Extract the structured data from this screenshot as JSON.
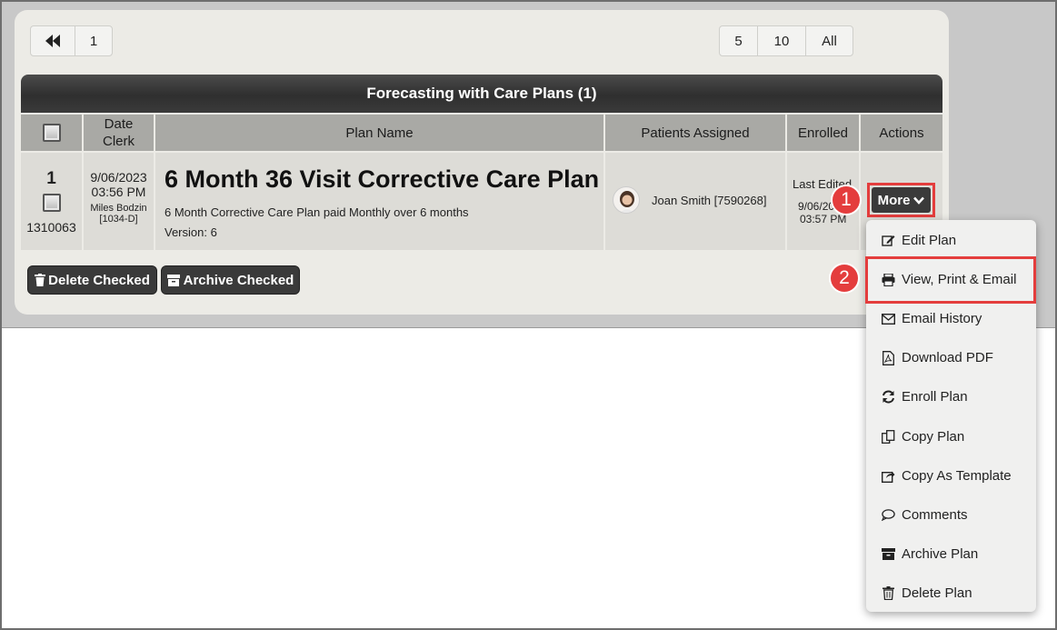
{
  "pager": {
    "first_icon": "double-left-arrow-icon",
    "page": "1",
    "sizes": [
      "5",
      "10",
      "All"
    ]
  },
  "table": {
    "title": "Forecasting with Care Plans (1)",
    "headers": {
      "date_clerk": "Date\nClerk",
      "plan_name": "Plan Name",
      "patients_assigned": "Patients Assigned",
      "enrolled": "Enrolled",
      "actions": "Actions"
    },
    "row": {
      "index": "1",
      "id": "1310063",
      "date": "9/06/2023",
      "time": "03:56 PM",
      "clerk": "Miles Bodzin",
      "clerk_code": "[1034-D]",
      "plan_title": "6 Month 36 Visit Corrective Care Plan",
      "plan_desc": "6 Month Corrective Care Plan paid Monthly over 6 months",
      "version": "Version: 6",
      "patient": "Joan Smith [7590268]",
      "last_edited": "Last Edited",
      "edited_date": "9/06/2023",
      "edited_time": "03:57 PM",
      "more_label": "More"
    }
  },
  "buttons": {
    "delete_checked": "Delete Checked",
    "archive_checked": "Archive Checked"
  },
  "menu": {
    "items": [
      {
        "label": "Edit Plan",
        "icon": "edit-icon"
      },
      {
        "label": "View, Print & Email",
        "icon": "print-icon"
      },
      {
        "label": "Email History",
        "icon": "envelope-icon"
      },
      {
        "label": "Download PDF",
        "icon": "pdf-icon"
      },
      {
        "label": "Enroll Plan",
        "icon": "refresh-icon"
      },
      {
        "label": "Copy Plan",
        "icon": "copy-icon"
      },
      {
        "label": "Copy As Template",
        "icon": "share-icon"
      },
      {
        "label": "Comments",
        "icon": "comment-icon"
      },
      {
        "label": "Archive Plan",
        "icon": "archive-icon"
      },
      {
        "label": "Delete Plan",
        "icon": "trash-icon"
      }
    ]
  },
  "annotations": {
    "step1": "1",
    "step2": "2",
    "highlight_color": "#e43d3d"
  },
  "colors": {
    "header_bar": "#3a3a3a",
    "column_header": "#a9a9a5",
    "row_bg": "#dddcd7",
    "panel_bg": "#ecebe6"
  }
}
